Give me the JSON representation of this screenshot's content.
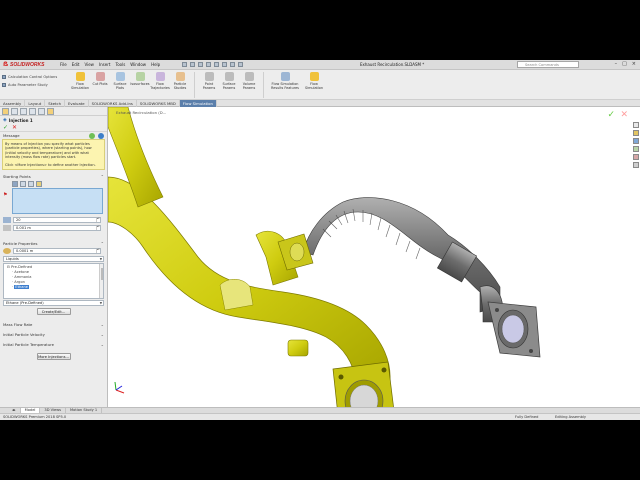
{
  "app": {
    "brand": "SOLIDWORKS",
    "menus": [
      "File",
      "Edit",
      "View",
      "Insert",
      "Tools",
      "Window",
      "Help"
    ],
    "document_title": "Exhaust Recirculation.SLDASM *",
    "search_placeholder": "Search Commands"
  },
  "ribbon": {
    "small_items": [
      "Calculation Control Options",
      "Auto Parameter Study"
    ],
    "buttons": [
      "Flow Simulation",
      "Cut Plots",
      "Surface Plots",
      "Isosurfaces",
      "Flow Trajectories",
      "Particle Studies",
      "Point Params",
      "Surface Params",
      "Volume Params",
      "Flow Simulation Results Features",
      "Flow Simulation"
    ]
  },
  "tabs": [
    "Assembly",
    "Layout",
    "Sketch",
    "Evaluate",
    "SOLIDWORKS Add-Ins",
    "SOLIDWORKS MBD",
    "Flow Simulation"
  ],
  "active_tab": "Flow Simulation",
  "panel": {
    "title": "Injection 1",
    "message_header": "Message",
    "message_p1": "By means of Injection you specify what particles (particle properties), where (starting points), how (initial velocity and temperature) and with what intensity (mass flow rate) particles start.",
    "message_p2": "Click <More Injections> to define another Injection.",
    "starting_points_header": "Starting Points",
    "count_value": "20",
    "size_value": "0.001 m",
    "particle_props_header": "Particle Properties",
    "diameter_value": "0.0001 m",
    "material_type": "Liquids",
    "list_root": "Pre-Defined",
    "list_items": [
      "Acetone",
      "Ammonia",
      "Argon",
      "Ethane"
    ],
    "selected_item": "Ethane",
    "list_source": "Ethane (Pre-Defined)",
    "create_edit_label": "Create/Edit...",
    "mass_flow_header": "Mass Flow Rate",
    "init_velocity_header": "Initial Particle Velocity",
    "init_temp_header": "Initial Particle Temperature",
    "more_injections_label": "More Injections..."
  },
  "viewport": {
    "breadcrumb": "Exhaust Recirculation (D..."
  },
  "bottom_tabs": [
    "Model",
    "3D Views",
    "Motion Study 1"
  ],
  "status": {
    "left": "SOLIDWORKS Premium 2018 SP5.0",
    "mid": "Fully Defined",
    "right": "Editing Assembly"
  },
  "colors": {
    "active_tab": "#5b7fab",
    "part_yellow": "#d8d61e",
    "part_gray": "#8a8a8a",
    "message_bg": "#fcf4b0"
  }
}
